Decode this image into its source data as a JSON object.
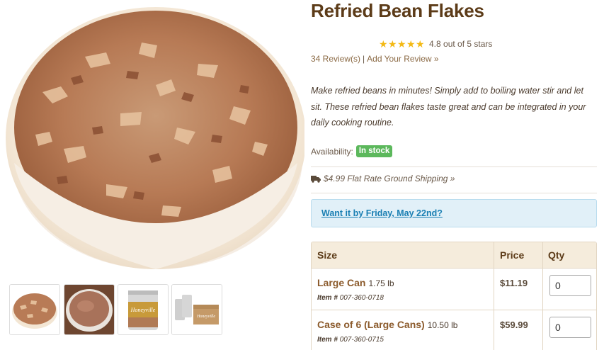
{
  "product": {
    "title": "Refried Bean Flakes",
    "rating": {
      "stars": 5,
      "score_text": "4.8 out of 5 stars"
    },
    "reviews": {
      "count_label": "34 Review(s)",
      "separator": "|",
      "add_label": "Add Your Review »"
    },
    "description": "Make refried beans in minutes! Simply add to boiling water stir and let sit. These refried bean flakes taste great and can be integrated in your daily cooking routine.",
    "availability": {
      "label": "Availability:",
      "status": "In stock"
    },
    "shipping": {
      "label": "$4.99 Flat Rate Ground Shipping »"
    },
    "delivery": {
      "label": "Want it by Friday, May 22nd?"
    }
  },
  "images": {
    "main": {
      "icon": "bowl-of-bean-flakes"
    },
    "thumbnails": [
      {
        "icon": "bean-flakes-bowl-thumb"
      },
      {
        "icon": "refried-beans-dish-thumb"
      },
      {
        "icon": "large-can-thumb"
      },
      {
        "icon": "case-of-cans-thumb",
        "brand": "Honeyville"
      }
    ],
    "can_brand": "Honeyville"
  },
  "table": {
    "headers": {
      "size": "Size",
      "price": "Price",
      "qty": "Qty"
    },
    "rows": [
      {
        "name": "Large Can",
        "weight": "1.75 lb",
        "item_label": "Item #",
        "item_number": "007-360-0718",
        "price": "$11.19",
        "qty": "0"
      },
      {
        "name": "Case of 6 (Large Cans)",
        "weight": "10.50 lb",
        "item_label": "Item #",
        "item_number": "007-360-0715",
        "price": "$59.99",
        "qty": "0"
      }
    ]
  },
  "colors": {
    "title": "#5c3b18",
    "star": "#f3b914",
    "badge": "#5cb85c",
    "link_blue": "#1a7fb3",
    "delivery_bg": "#e1f0f8",
    "table_header_bg": "#f5ecdc"
  }
}
